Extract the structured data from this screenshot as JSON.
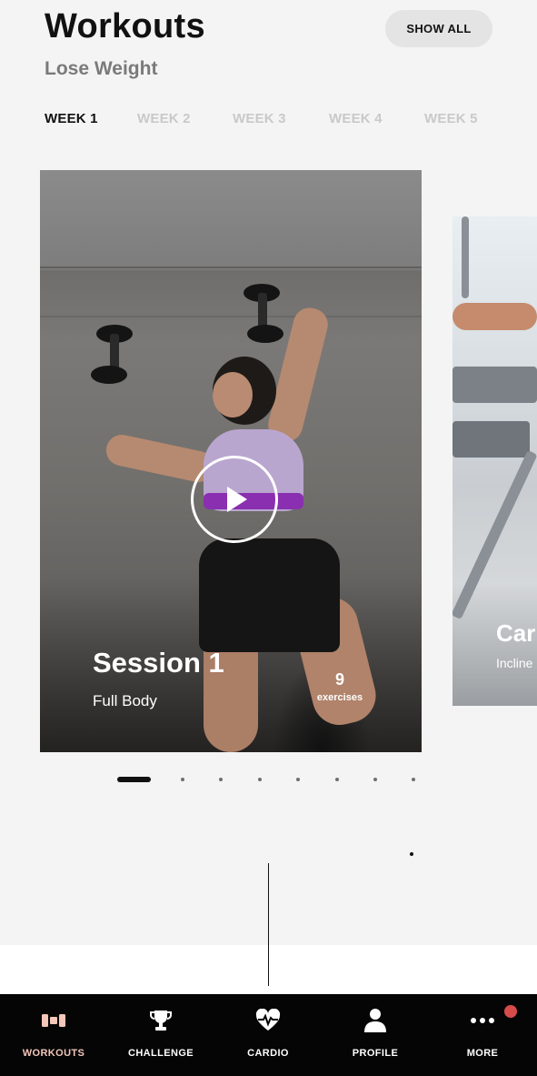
{
  "header": {
    "title": "Workouts",
    "subtitle": "Lose Weight",
    "show_all_label": "SHOW ALL"
  },
  "week_tabs": [
    {
      "label": "WEEK 1",
      "active": true
    },
    {
      "label": "WEEK 2",
      "active": false
    },
    {
      "label": "WEEK 3",
      "active": false
    },
    {
      "label": "WEEK 4",
      "active": false
    },
    {
      "label": "WEEK 5",
      "active": false
    }
  ],
  "cards": [
    {
      "title": "Session 1",
      "subtitle": "Full Body",
      "exercise_count": "9",
      "exercise_label": "exercises"
    },
    {
      "title": "Car",
      "subtitle": "Incline"
    }
  ],
  "pager": {
    "total": 9,
    "active_index": 0
  },
  "nav": [
    {
      "label": "WORKOUTS",
      "icon": "dumbbell-icon",
      "active": true
    },
    {
      "label": "CHALLENGE",
      "icon": "trophy-icon",
      "active": false
    },
    {
      "label": "CARDIO",
      "icon": "heartbeat-icon",
      "active": false
    },
    {
      "label": "PROFILE",
      "icon": "person-icon",
      "active": false
    },
    {
      "label": "MORE",
      "icon": "more-dots-icon",
      "active": false,
      "badge": true
    }
  ],
  "colors": {
    "accent": "#f3c7b9",
    "badge": "#d84b4b",
    "nav_background": "#050505",
    "page_background": "#f4f4f4"
  }
}
